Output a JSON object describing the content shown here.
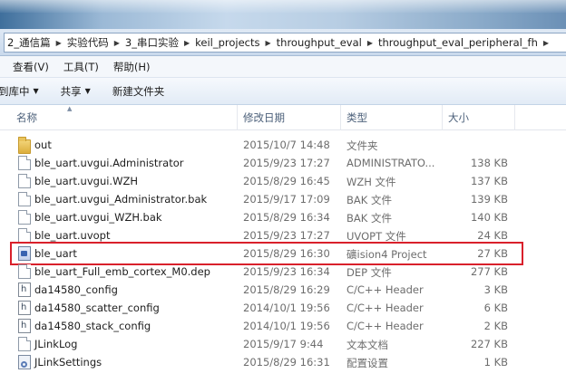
{
  "breadcrumb": [
    "2_通信篇",
    "实验代码",
    "3_串口实验",
    "keil_projects",
    "throughput_eval",
    "throughput_eval_peripheral_fh"
  ],
  "breadcrumb_separator": "▶",
  "menu": {
    "view": "查看(V)",
    "tools": "工具(T)",
    "help": "帮助(H)"
  },
  "toolbar": {
    "include_in_library": "到库中",
    "share": "共享",
    "new_folder": "新建文件夹",
    "dropdown_glyph": "▼"
  },
  "columns": {
    "name": "名称",
    "modified": "修改日期",
    "type": "类型",
    "size": "大小"
  },
  "files": [
    {
      "name": "out",
      "modified": "2015/10/7 14:48",
      "type": "文件夹",
      "size": "",
      "icon": "folder-icon"
    },
    {
      "name": "ble_uart.uvgui.Administrator",
      "modified": "2015/9/23 17:27",
      "type": "ADMINISTRATO...",
      "size": "138 KB",
      "icon": "file-icon"
    },
    {
      "name": "ble_uart.uvgui.WZH",
      "modified": "2015/8/29 16:45",
      "type": "WZH 文件",
      "size": "137 KB",
      "icon": "file-icon"
    },
    {
      "name": "ble_uart.uvgui_Administrator.bak",
      "modified": "2015/9/17 17:09",
      "type": "BAK 文件",
      "size": "139 KB",
      "icon": "file-icon"
    },
    {
      "name": "ble_uart.uvgui_WZH.bak",
      "modified": "2015/8/29 16:34",
      "type": "BAK 文件",
      "size": "140 KB",
      "icon": "file-icon"
    },
    {
      "name": "ble_uart.uvopt",
      "modified": "2015/9/23 17:27",
      "type": "UVOPT 文件",
      "size": "24 KB",
      "icon": "file-icon"
    },
    {
      "name": "ble_uart",
      "modified": "2015/8/29 16:30",
      "type": "礦ision4 Project",
      "size": "27 KB",
      "icon": "project-icon"
    },
    {
      "name": "ble_uart_Full_emb_cortex_M0.dep",
      "modified": "2015/9/23 16:34",
      "type": "DEP 文件",
      "size": "277 KB",
      "icon": "file-icon"
    },
    {
      "name": "da14580_config",
      "modified": "2015/8/29 16:29",
      "type": "C/C++ Header",
      "size": "3 KB",
      "icon": "header-icon"
    },
    {
      "name": "da14580_scatter_config",
      "modified": "2014/10/1 19:56",
      "type": "C/C++ Header",
      "size": "6 KB",
      "icon": "header-icon"
    },
    {
      "name": "da14580_stack_config",
      "modified": "2014/10/1 19:56",
      "type": "C/C++ Header",
      "size": "2 KB",
      "icon": "header-icon"
    },
    {
      "name": "JLinkLog",
      "modified": "2015/9/17 9:44",
      "type": "文本文档",
      "size": "227 KB",
      "icon": "file-icon"
    },
    {
      "name": "JLinkSettings",
      "modified": "2015/8/29 16:31",
      "type": "配置设置",
      "size": "1 KB",
      "icon": "settings-icon"
    }
  ],
  "highlight_color": "#d9202b"
}
